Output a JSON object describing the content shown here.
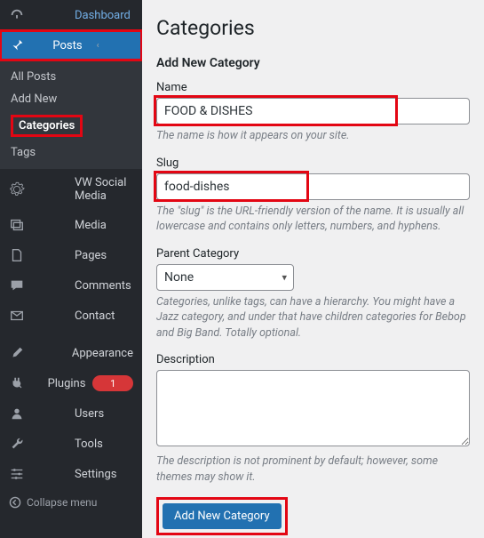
{
  "sidebar": {
    "items": [
      {
        "label": "Dashboard",
        "icon": "dashboard"
      },
      {
        "label": "Posts",
        "icon": "pin",
        "active": true,
        "highlight": true,
        "chev": "‹",
        "submenu": [
          {
            "label": "All Posts"
          },
          {
            "label": "Add New"
          },
          {
            "label": "Categories",
            "current": true,
            "highlight": true
          },
          {
            "label": "Tags"
          }
        ]
      },
      {
        "label": "VW Social Media",
        "icon": "gear"
      },
      {
        "label": "Media",
        "icon": "media"
      },
      {
        "label": "Pages",
        "icon": "page"
      },
      {
        "label": "Comments",
        "icon": "comment"
      },
      {
        "label": "Contact",
        "icon": "mail"
      }
    ],
    "items2": [
      {
        "label": "Appearance",
        "icon": "brush"
      },
      {
        "label": "Plugins",
        "icon": "plug",
        "badge": "1"
      },
      {
        "label": "Users",
        "icon": "user"
      },
      {
        "label": "Tools",
        "icon": "wrench"
      },
      {
        "label": "Settings",
        "icon": "sliders"
      }
    ],
    "collapse_label": "Collapse menu"
  },
  "page": {
    "title": "Categories",
    "section": "Add New Category",
    "name_label": "Name",
    "name_value": "FOOD & DISHES",
    "name_help": "The name is how it appears on your site.",
    "slug_label": "Slug",
    "slug_value": "food-dishes",
    "slug_help": "The \"slug\" is the URL-friendly version of the name. It is usually all lowercase and contains only letters, numbers, and hyphens.",
    "parent_label": "Parent Category",
    "parent_value": "None",
    "parent_help": "Categories, unlike tags, can have a hierarchy. You might have a Jazz category, and under that have children categories for Bebop and Big Band. Totally optional.",
    "desc_label": "Description",
    "desc_value": "",
    "desc_help": "The description is not prominent by default; however, some themes may show it.",
    "submit_label": "Add New Category"
  }
}
